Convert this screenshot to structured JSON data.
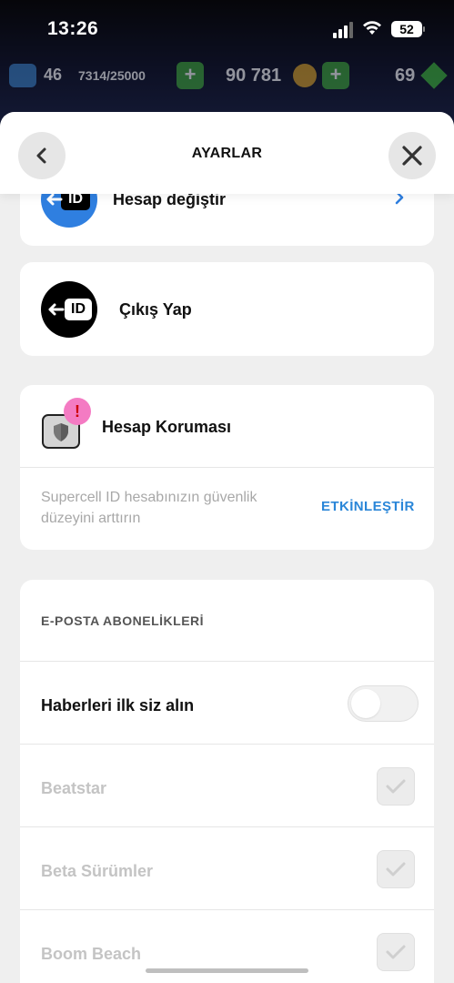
{
  "status_bar": {
    "time": "13:26",
    "battery": "52"
  },
  "hud": {
    "level": "46",
    "xp": "7314/25000",
    "coins": "90 781",
    "gems": "69",
    "plus": "+"
  },
  "header": {
    "title": "AYARLAR",
    "back_icon": "chevron-left-icon",
    "close_icon": "close-icon"
  },
  "account_switch": {
    "label": "Hesap değiştir",
    "tag": "ID",
    "accent": "#2f7fe0"
  },
  "logout": {
    "label": "Çıkış Yap",
    "tag": "ID"
  },
  "protection": {
    "title": "Hesap Koruması",
    "badge": "!",
    "description": "Supercell ID hesabınızın güvenlik düzeyini arttırın",
    "action": "ETKİNLEŞTİR",
    "accent": "#2a86d8",
    "badge_color": "#f47bc3"
  },
  "email": {
    "heading": "E-POSTA ABONELİKLERİ",
    "newsletter_label": "Haberleri ilk siz alın",
    "newsletter_on": false,
    "games": [
      {
        "label": "Beatstar",
        "checked": true
      },
      {
        "label": "Beta Sürümler",
        "checked": true
      },
      {
        "label": "Boom Beach",
        "checked": true
      }
    ]
  }
}
